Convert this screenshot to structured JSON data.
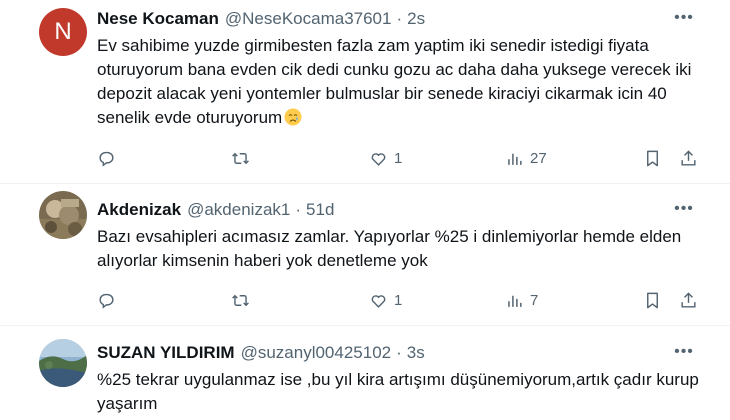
{
  "tweets": [
    {
      "name": "Nese Kocaman",
      "handle": "@NeseKocama37601",
      "time": "2s",
      "avatar_letter": "N",
      "avatar_color": "#c0392b",
      "text": "Ev sahibime yuzde girmibesten fazla zam yaptim iki senedir istedigi fiyata oturuyorum bana evden cik dedi cunku gozu ac daha daha yuksege verecek iki depozit alacak yeni yontemler bulmuslar bir senede kiraciyi cikarmak icin 40 senelik evde oturuyorum",
      "emoji": "crying-face-icon",
      "likes": "1",
      "views": "27"
    },
    {
      "name": "Akdenizak",
      "handle": "@akdenizak1",
      "time": "51d",
      "text": "Bazı evsahipleri acımasız zamlar. Yapıyorlar %25 i  dinlemiyorlar hemde elden alıyorlar kimsenin haberi yok denetleme yok",
      "likes": "1",
      "views": "7"
    },
    {
      "name": "SUZAN YILDIRIM",
      "handle": "@suzanyl00425102",
      "time": "3s",
      "text": "%25 tekrar uygulanmaz ise ,bu yıl kira artışımı düşünemiyorum,artık çadır kurup yaşarım"
    }
  ],
  "separator_dot": "·",
  "colors": {
    "secondary_text": "#536471",
    "divider": "#eff3f4",
    "text": "#0f1419"
  }
}
